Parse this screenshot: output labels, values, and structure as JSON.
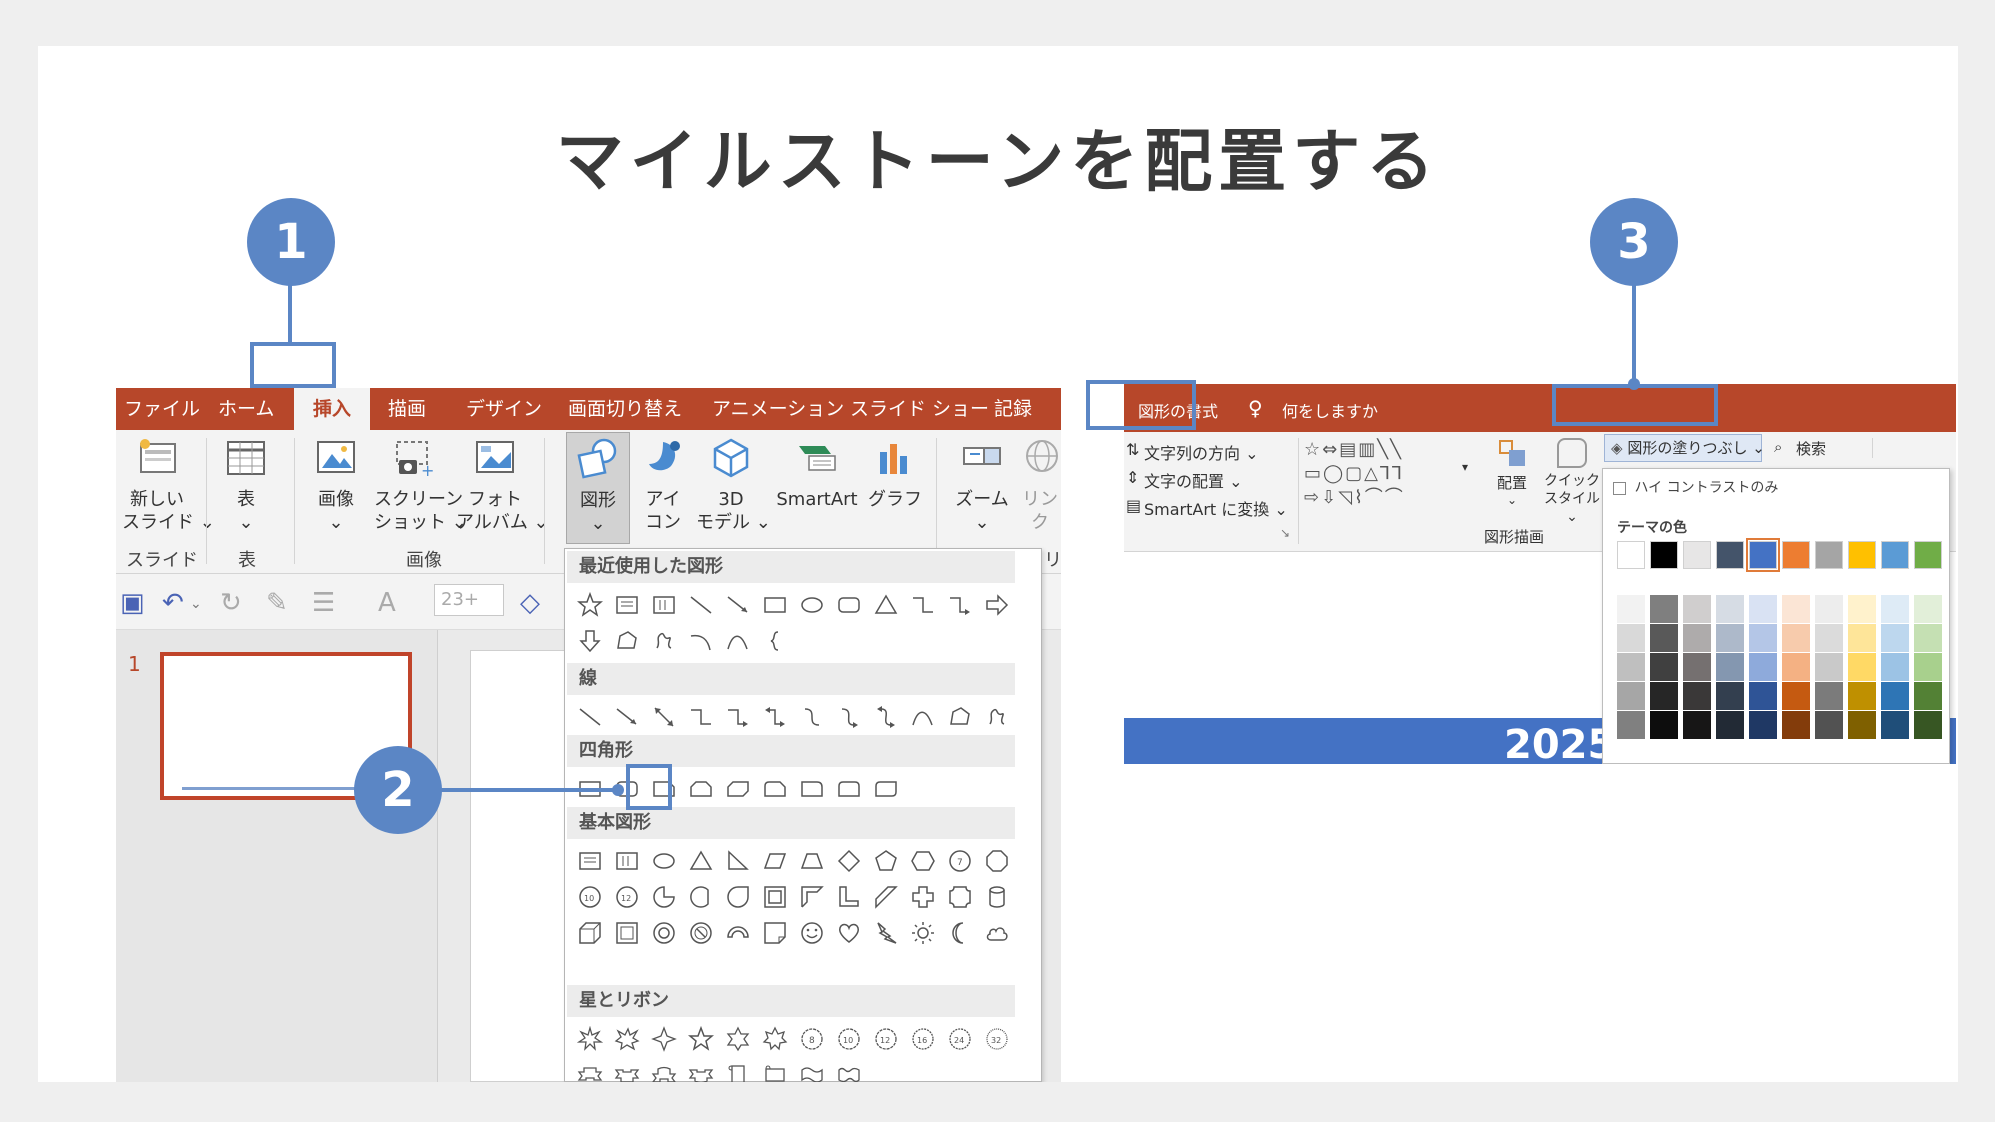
{
  "title": "マイルストーンを配置する",
  "steps": [
    "1",
    "2",
    "3"
  ],
  "left": {
    "tabs": [
      "ファイル",
      "ホーム",
      "挿入",
      "描画",
      "デザイン",
      "画面切り替え",
      "アニメーション",
      "スライド ショー",
      "記録"
    ],
    "ribbon": {
      "new_slide": [
        "新しい",
        "スライド ⌄"
      ],
      "table": [
        "表",
        "⌄"
      ],
      "image": [
        "画像",
        "⌄"
      ],
      "screenshot": [
        "スクリーン",
        "ショット ⌄"
      ],
      "photo_album": [
        "フォト",
        "アルバム ⌄"
      ],
      "shapes": [
        "図形",
        "⌄"
      ],
      "icons": [
        "アイ",
        "コン"
      ],
      "model3d": [
        "3D",
        "モデル ⌄"
      ],
      "smartart": "SmartArt",
      "chart": "グラフ",
      "zoom": [
        "ズーム",
        "⌄"
      ],
      "link": [
        "リン",
        "ク"
      ],
      "groups": [
        "スライド",
        "表",
        "画像",
        "リンク"
      ]
    },
    "qat": {
      "font_size": "23+"
    },
    "slide_number": "1",
    "dropdown": {
      "recent": "最近使用した図形",
      "lines": "線",
      "rectangles": "四角形",
      "basic": "基本図形",
      "stars": "星とリボン"
    }
  },
  "right": {
    "tab": "図形の書式",
    "tellme": "何をしますか",
    "ribbon": {
      "text_direction": "文字列の方向 ⌄",
      "text_align": "文字の配置 ⌄",
      "smartart_convert": "SmartArt に変換 ⌄",
      "arrange": "配置",
      "quick_style": [
        "クイック",
        "スタイル ⌄"
      ],
      "group_label": "図形描画",
      "shape_fill": "図形の塗りつぶし ⌄",
      "search": "検索"
    },
    "fill_menu": {
      "high_contrast": "ハイ コントラストのみ",
      "theme_colors": "テーマの色",
      "theme_row": [
        "#ffffff",
        "#000000",
        "#e7e6e6",
        "#44546a",
        "#4472c4",
        "#ed7d31",
        "#a5a5a5",
        "#ffc000",
        "#5b9bd5",
        "#70ad47"
      ],
      "shades": [
        [
          "#f2f2f2",
          "#d9d9d9",
          "#bfbfbf",
          "#a6a6a6",
          "#808080"
        ],
        [
          "#7f7f7f",
          "#595959",
          "#404040",
          "#262626",
          "#0d0d0d"
        ],
        [
          "#d0cece",
          "#aeabab",
          "#757070",
          "#3a3838",
          "#171616"
        ],
        [
          "#d6dce4",
          "#adb9ca",
          "#8497b0",
          "#333f4f",
          "#222a35"
        ],
        [
          "#d9e2f3",
          "#b4c6e7",
          "#8eaadb",
          "#2f5496",
          "#1f3864"
        ],
        [
          "#fbe5d5",
          "#f7cbac",
          "#f4b183",
          "#c55a11",
          "#833c0b"
        ],
        [
          "#ededed",
          "#dbdbdb",
          "#c9c9c9",
          "#7b7b7b",
          "#525252"
        ],
        [
          "#fff2cc",
          "#fee599",
          "#ffd965",
          "#bf9000",
          "#7f6000"
        ],
        [
          "#deebf6",
          "#bdd7ee",
          "#9cc3e5",
          "#2e75b5",
          "#1f4e79"
        ],
        [
          "#e2efd9",
          "#c5e0b3",
          "#a8d08d",
          "#538135",
          "#375623"
        ]
      ]
    },
    "year_partial": "2025"
  }
}
